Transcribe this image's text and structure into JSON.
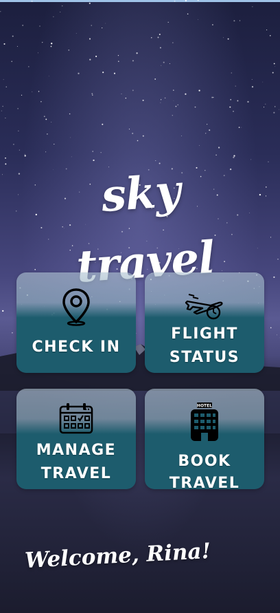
{
  "app": {
    "logo_text": "sky travel"
  },
  "tiles": {
    "check_in": {
      "label": "CHECK IN",
      "icon": "location-pin-icon"
    },
    "flight_status": {
      "line1": "FLIGHT",
      "line2": "STATUS",
      "icon": "airplane-clock-icon"
    },
    "manage_travel": {
      "line1": "MANAGE",
      "line2": "TRAVEL",
      "icon": "calendar-icon"
    },
    "book_travel": {
      "label": "BOOK TRAVEL",
      "icon": "hotel-icon",
      "icon_sign": "HOTEL"
    }
  },
  "greeting": "Welcome, Rina!",
  "colors": {
    "tile_teal": "#1d5c6d",
    "sky_top": "#1c1f3e",
    "text": "#ffffff"
  }
}
